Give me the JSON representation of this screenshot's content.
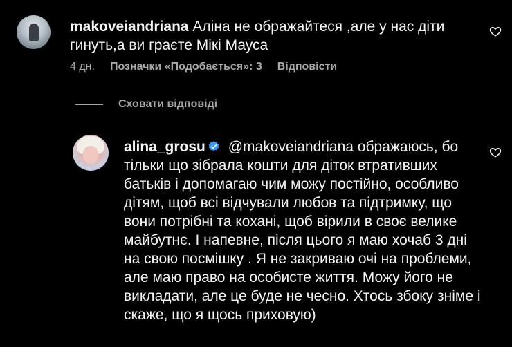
{
  "comments": [
    {
      "username": "makoveiandriana",
      "text": " Аліна не ображайтеся ,але у нас діти гинуть,а ви граєте Мікі Мауса",
      "time": "4 дн.",
      "likes": "Позначки «Подобається»: 3",
      "reply": "Відповісти"
    }
  ],
  "hide_replies_label": "Сховати відповіді",
  "reply": {
    "username": "alina_grosu",
    "mention": "@makoveiandriana",
    "text": " ображаюсь, бо тільки що зібрала кошти для діток втративших батьків і допомагаю чим можу постійно, особливо дітям, щоб всі відчували любов та підтримку, що вони потрібні та кохані, щоб вірили в своє велике майбутнє. І напевне, після цього я маю хочаб 3 дні на свою посмішку . Я не закриваю очі на проблеми, але маю право на особисте життя. Можу його не викладати, але це буде не чесно. Хтось збоку зніме і скаже, що я щось приховую)",
    "verified": true
  },
  "icons": {
    "like": "heart-outline-icon",
    "verified": "verified-badge-icon",
    "verified_color": "#3897f0"
  }
}
